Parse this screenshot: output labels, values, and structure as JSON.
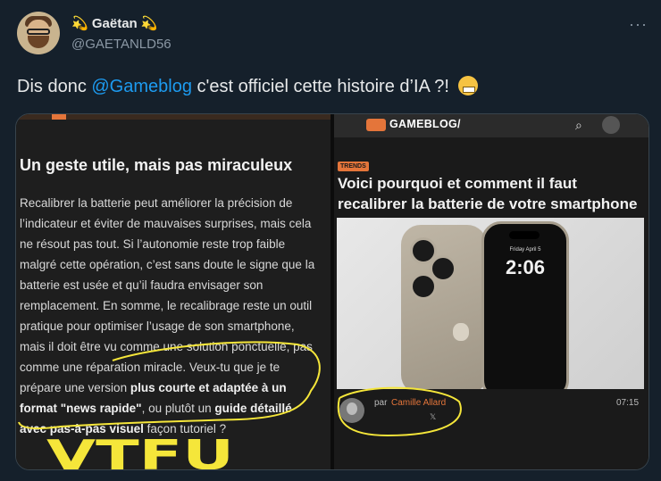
{
  "tweet": {
    "display_name": "💫 Gaëtan 💫",
    "handle": "@GAETANLD56",
    "more_label": "···",
    "text_before": "Dis donc ",
    "mention": "@Gameblog",
    "text_after": " c'est officiel cette histoire d’IA ?! "
  },
  "left_article": {
    "heading": "Un geste utile, mais pas miraculeux",
    "body_1": "Recalibrer la batterie peut améliorer la précision de l’indicateur et éviter de mauvaises surprises, mais cela ne résout pas tout. Si l’autonomie reste trop faible malgré cette opération, c’est sans doute le signe que la batterie est usée et qu’il faudra envisager son remplacement. En somme, le recalibrage reste un outil pratique pour optimiser l’usage de son smartphone, mais il doit être vu comme une solution ponctuelle, pas comme une réparation miracle. Veux-tu que je te prépare une version ",
    "bold_1": "plus courte et adaptée à un format \"news rapide\"",
    "body_2": ", ou plutôt un ",
    "bold_2": "guide détaillé avec pas-à-pas visuel",
    "body_3": " façon tutoriel ?",
    "handwritten": "VTFU"
  },
  "right_article": {
    "site_name": "GAMEBLOG/",
    "badge": "TRENDS",
    "heading": "Voici pourquoi et comment il faut recalibrer la batterie de votre smartphone",
    "lock_date": "Friday April 5",
    "lock_time": "2:06",
    "author_prefix": "par",
    "author_name": "Camille Allard",
    "x_icon": "𝕏",
    "time": "07:15"
  },
  "colors": {
    "background": "#15202b",
    "link": "#1d9bf0",
    "gameblog_orange": "#e4753a",
    "highlight_yellow": "#f5e63a"
  }
}
